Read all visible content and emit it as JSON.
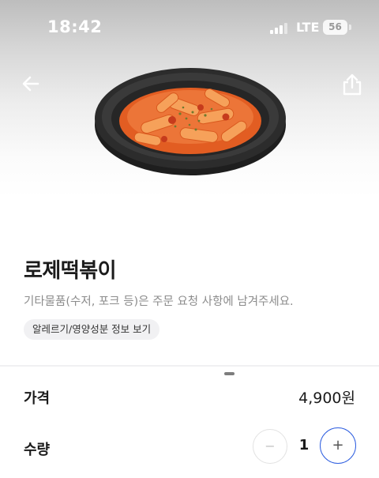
{
  "status_bar": {
    "time": "18:42",
    "network": "LTE",
    "battery": "56"
  },
  "header": {
    "back_icon": "arrow-left-icon",
    "share_icon": "share-icon"
  },
  "product": {
    "image": "tteokbokki-dish",
    "name": "로제떡볶이",
    "description": "기타물품(수저, 포크 등)은 주문 요청 사항에 남겨주세요.",
    "allergy_link": "알레르기/영양성분 정보 보기"
  },
  "order": {
    "price_label": "가격",
    "price_value": "4,900원",
    "quantity_label": "수량",
    "quantity_value": "1",
    "minus_symbol": "−",
    "plus_symbol": "+"
  },
  "colors": {
    "accent": "#2f5fe0",
    "sauce": "#e8672c",
    "bowl": "#2a2a2a"
  }
}
